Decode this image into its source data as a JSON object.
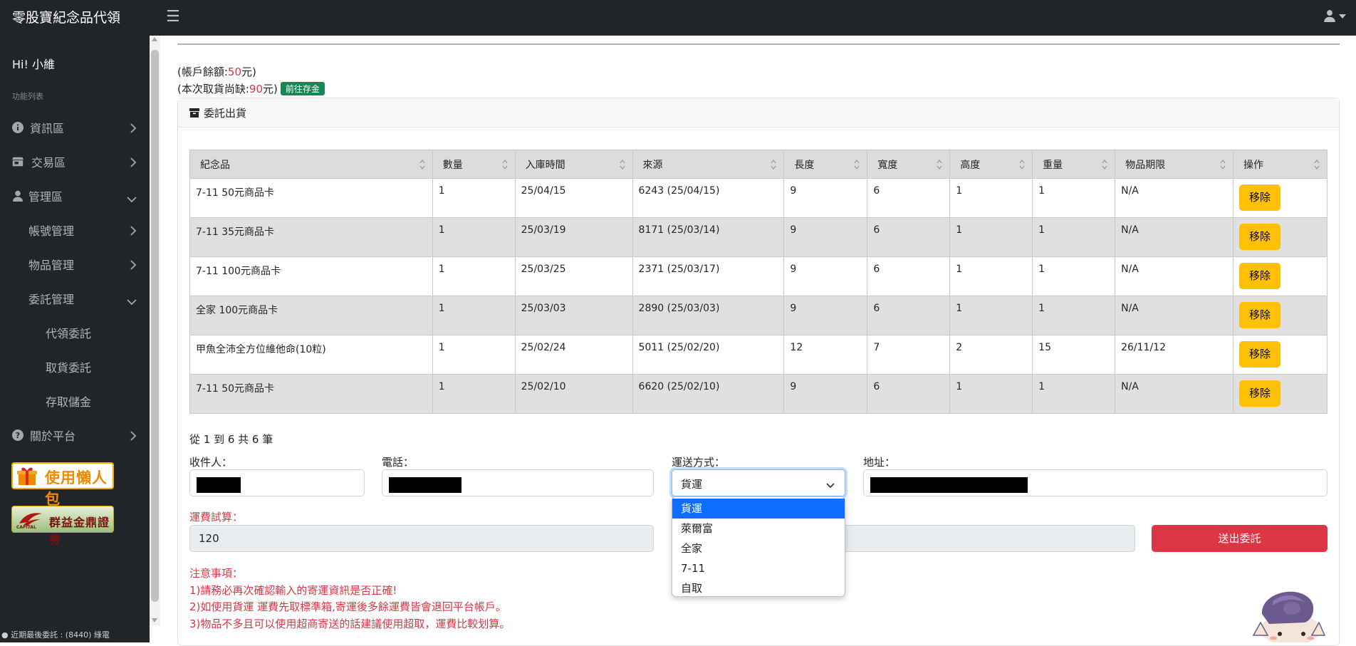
{
  "app": {
    "title": "零股寶紀念品代領"
  },
  "sidebar": {
    "greeting": "Hi! 小維",
    "heading": "功能列表",
    "items": [
      {
        "label": "資訊區",
        "icon": "info-circle-icon"
      },
      {
        "label": "交易區",
        "icon": "store-icon"
      },
      {
        "label": "管理區",
        "icon": "user-icon"
      },
      {
        "label": "帳號管理"
      },
      {
        "label": "物品管理"
      },
      {
        "label": "委託管理"
      },
      {
        "label": "代領委託"
      },
      {
        "label": "取貨委託"
      },
      {
        "label": "存取儲金"
      },
      {
        "label": "關於平台",
        "icon": "question-circle-icon"
      }
    ],
    "promo1": "使用懶人包",
    "promo2": "群益金鼎證券",
    "promo2_sub": "CAPITAL"
  },
  "footer": {
    "status": "近期最後委託 : (8440) 綠電"
  },
  "account": {
    "balance_prefix": "(帳戶餘額:",
    "balance_value": "50",
    "balance_suffix": "元)",
    "owe_prefix": "(本次取貨尚缺:",
    "owe_value": "90",
    "owe_suffix": "元)",
    "deposit_label": "前往存金"
  },
  "card": {
    "title": "委託出貨"
  },
  "table": {
    "headers": [
      "紀念品",
      "數量",
      "入庫時間",
      "來源",
      "長度",
      "寬度",
      "高度",
      "重量",
      "物品期限",
      "操作"
    ],
    "rows": [
      [
        "7-11 50元商品卡",
        "1",
        "25/04/15",
        "6243 (25/04/15)",
        "9",
        "6",
        "1",
        "1",
        "N/A"
      ],
      [
        "7-11 35元商品卡",
        "1",
        "25/03/19",
        "8171 (25/03/14)",
        "9",
        "6",
        "1",
        "1",
        "N/A"
      ],
      [
        "7-11 100元商品卡",
        "1",
        "25/03/25",
        "2371 (25/03/17)",
        "9",
        "6",
        "1",
        "1",
        "N/A"
      ],
      [
        "全家 100元商品卡",
        "1",
        "25/03/03",
        "2890 (25/03/03)",
        "9",
        "6",
        "1",
        "1",
        "N/A"
      ],
      [
        "甲魚全沛全方位維他命(10粒)",
        "1",
        "25/02/24",
        "5011 (25/02/20)",
        "12",
        "7",
        "2",
        "15",
        "26/11/12"
      ],
      [
        "7-11 50元商品卡",
        "1",
        "25/02/10",
        "6620 (25/02/10)",
        "9",
        "6",
        "1",
        "1",
        "N/A"
      ]
    ],
    "action_label": "移除"
  },
  "pagination": {
    "text": "從 1 到 6 共 6 筆"
  },
  "form": {
    "recipient_label": "收件人：",
    "phone_label": "電話：",
    "shipping_label": "運送方式：",
    "shipping_value": "貨運",
    "address_label": "地址：",
    "fee_label": "運費試算：",
    "fee_value": "120",
    "submit_label": "送出委託"
  },
  "dropdown": {
    "options": [
      "貨運",
      "萊爾富",
      "全家",
      "7-11",
      "自取"
    ],
    "selected": "貨運"
  },
  "notes": [
    "注意事項：",
    "1)請務必再次確認輸入的寄運資訊是否正確!",
    "2)如使用貨運 運費先取標準箱,寄運後多餘運費皆會退回平台帳戶。",
    "3)物品不多且可以使用超商寄送的話建議使用超取，運費比較划算。"
  ],
  "colors": {
    "accent_red": "#dc3545",
    "warning": "#ffc107",
    "success": "#198754",
    "primary": "#0d6efd",
    "dark": "#212529"
  }
}
